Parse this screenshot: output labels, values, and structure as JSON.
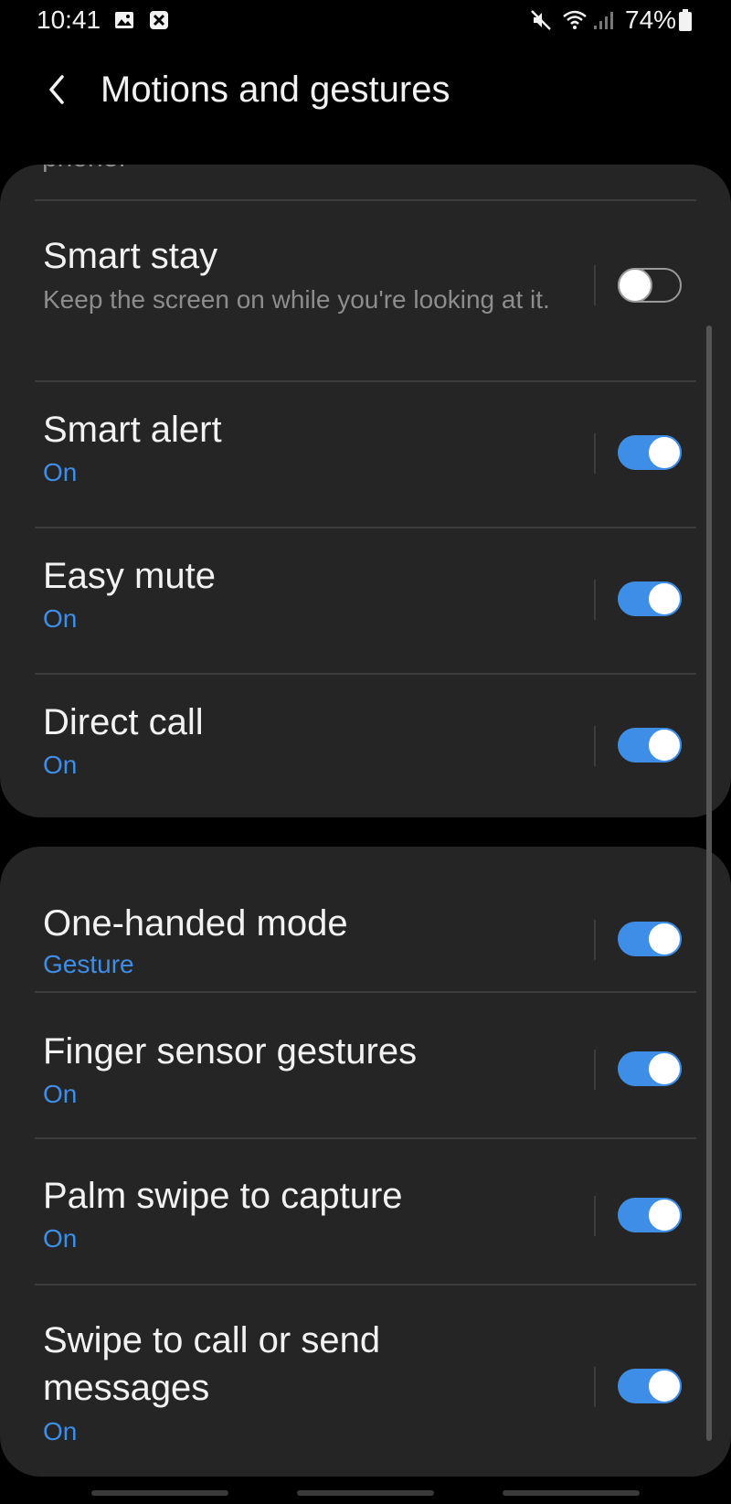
{
  "status_bar": {
    "time": "10:41",
    "battery": "74%",
    "icons": [
      "gallery-icon",
      "blocked-notification-icon",
      "mute-icon",
      "wifi-icon",
      "signal-icon",
      "battery-icon"
    ]
  },
  "header": {
    "back_icon": "chevron-left-icon",
    "title": "Motions and gestures"
  },
  "colors": {
    "background": "#000000",
    "card": "#252525",
    "accent": "#3e8de6",
    "text_primary": "#f2f2f2",
    "text_secondary": "#8d8d8d"
  },
  "card1": {
    "clipped_text": "phone.",
    "items": [
      {
        "title": "Smart stay",
        "subtitle": "Keep the screen on while you're looking at it.",
        "enabled": false
      },
      {
        "title": "Smart alert",
        "subtitle": "On",
        "enabled": true
      },
      {
        "title": "Easy mute",
        "subtitle": "On",
        "enabled": true
      },
      {
        "title": "Direct call",
        "subtitle": "On",
        "enabled": true
      }
    ]
  },
  "card2": {
    "items": [
      {
        "title": "One-handed mode",
        "subtitle": "Gesture",
        "enabled": true
      },
      {
        "title": "Finger sensor gestures",
        "subtitle": "On",
        "enabled": true
      },
      {
        "title": "Palm swipe to capture",
        "subtitle": "On",
        "enabled": true
      },
      {
        "title": "Swipe to call or send messages",
        "subtitle": "On",
        "enabled": true
      }
    ]
  }
}
